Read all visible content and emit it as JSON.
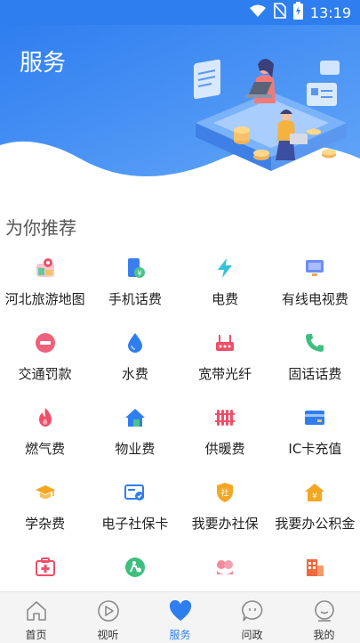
{
  "status": {
    "time": "13:19"
  },
  "header": {
    "title": "服务"
  },
  "section": {
    "title": "为你推荐"
  },
  "services": [
    {
      "label": "河北旅游地图",
      "icon": "map-icon"
    },
    {
      "label": "手机话费",
      "icon": "phone-bill-icon"
    },
    {
      "label": "电费",
      "icon": "lightning-icon"
    },
    {
      "label": "有线电视费",
      "icon": "tv-icon"
    },
    {
      "label": "交通罚款",
      "icon": "no-entry-icon"
    },
    {
      "label": "水费",
      "icon": "water-drop-icon"
    },
    {
      "label": "宽带光纤",
      "icon": "router-icon"
    },
    {
      "label": "固话话费",
      "icon": "telephone-icon"
    },
    {
      "label": "燃气费",
      "icon": "flame-icon"
    },
    {
      "label": "物业费",
      "icon": "house-icon"
    },
    {
      "label": "供暖费",
      "icon": "radiator-icon"
    },
    {
      "label": "IC卡充值",
      "icon": "card-icon"
    },
    {
      "label": "学杂费",
      "icon": "graduation-cap-icon"
    },
    {
      "label": "电子社保卡",
      "icon": "social-security-card-icon"
    },
    {
      "label": "我要办社保",
      "icon": "shield-icon"
    },
    {
      "label": "我要办公积金",
      "icon": "house-fund-icon"
    },
    {
      "label": "",
      "icon": "first-aid-kit-icon"
    },
    {
      "label": "",
      "icon": "driving-icon"
    },
    {
      "label": "",
      "icon": "couple-icon"
    },
    {
      "label": "",
      "icon": "building-icon"
    }
  ],
  "tabs": [
    {
      "label": "首页",
      "icon": "home-icon"
    },
    {
      "label": "视听",
      "icon": "play-icon"
    },
    {
      "label": "服务",
      "icon": "heart-icon",
      "active": true
    },
    {
      "label": "问政",
      "icon": "chat-icon"
    },
    {
      "label": "我的",
      "icon": "profile-icon"
    }
  ],
  "colors": {
    "brand": "#2f7ef0",
    "header_light": "#5b9ef7"
  }
}
